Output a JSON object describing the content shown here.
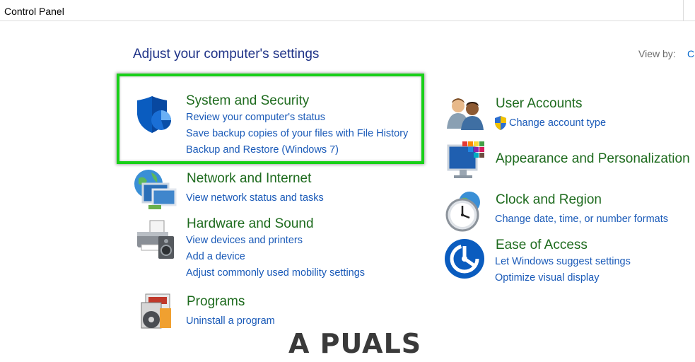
{
  "breadcrumb": "Control Panel",
  "heading": "Adjust your computer's settings",
  "view_by": {
    "label": "View by:",
    "value": "C"
  },
  "left_categories": [
    {
      "title": "System and Security",
      "icon": "shield-icon",
      "links": [
        "Review your computer's status",
        "Save backup copies of your files with File History",
        "Backup and Restore (Windows 7)"
      ]
    },
    {
      "title": "Network and Internet",
      "icon": "network-globe-icon",
      "links": [
        "View network status and tasks"
      ]
    },
    {
      "title": "Hardware and Sound",
      "icon": "printer-speaker-icon",
      "links": [
        "View devices and printers",
        "Add a device",
        "Adjust commonly used mobility settings"
      ]
    },
    {
      "title": "Programs",
      "icon": "programs-disc-icon",
      "links": [
        "Uninstall a program"
      ]
    }
  ],
  "right_categories": [
    {
      "title": "User Accounts",
      "icon": "users-icon",
      "links": [
        "Change account type"
      ],
      "link_icon": "uac-shield-icon"
    },
    {
      "title": "Appearance and Personalization",
      "icon": "monitor-palette-icon",
      "links": []
    },
    {
      "title": "Clock and Region",
      "icon": "clock-globe-icon",
      "links": [
        "Change date, time, or number formats"
      ]
    },
    {
      "title": "Ease of Access",
      "icon": "ease-of-access-icon",
      "links": [
        "Let Windows suggest settings",
        "Optimize visual display"
      ]
    }
  ],
  "watermark": "A PUALS",
  "colors": {
    "title_green": "#1e6b1e",
    "link_blue": "#1a5ab8",
    "heading_blue": "#1e3287",
    "highlight_green": "#18d018"
  }
}
